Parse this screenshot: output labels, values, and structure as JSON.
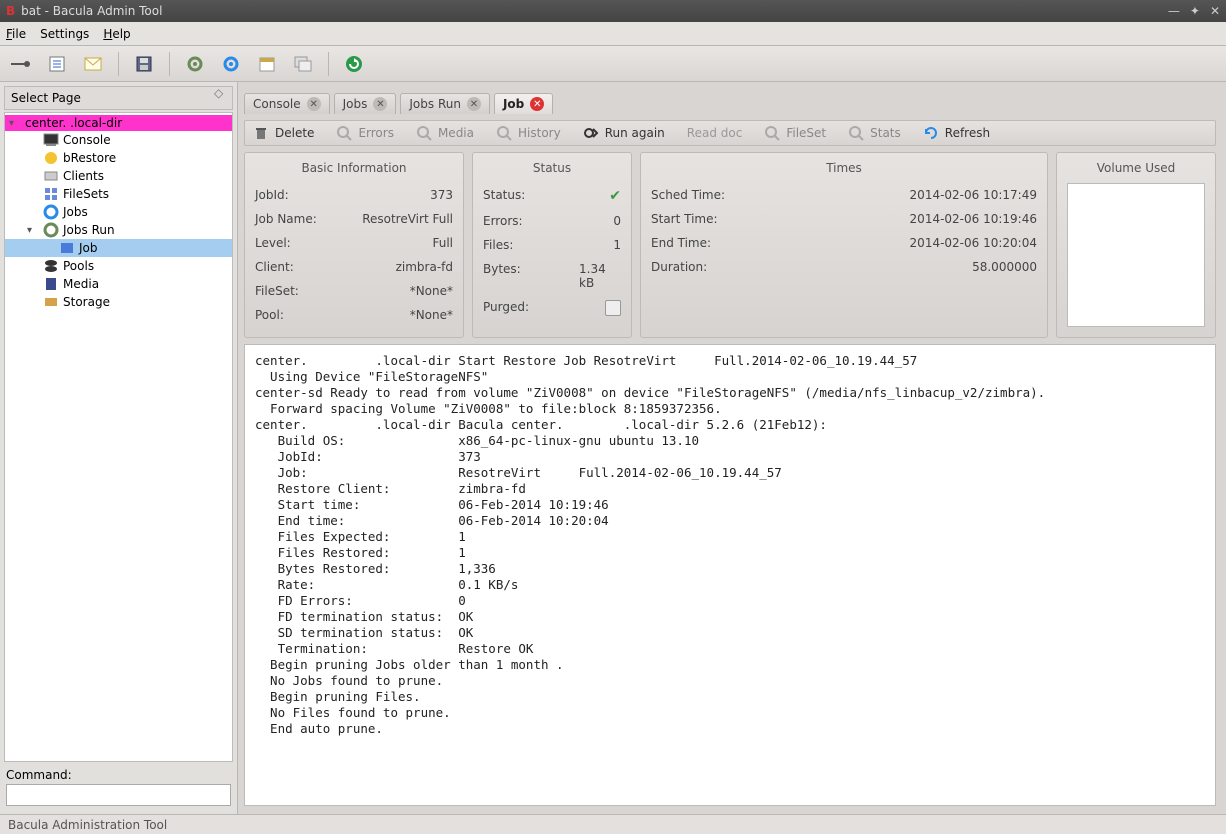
{
  "window": {
    "title": "bat - Bacula Admin Tool"
  },
  "menu": {
    "file": "File",
    "settings": "Settings",
    "help": "Help"
  },
  "sidebar": {
    "select_page": "Select Page",
    "root": "center.            .local-dir",
    "items": {
      "console": "Console",
      "brestore": "bRestore",
      "clients": "Clients",
      "filesets": "FileSets",
      "jobs": "Jobs",
      "jobsrun": "Jobs Run",
      "job": "Job",
      "pools": "Pools",
      "media": "Media",
      "storage": "Storage"
    },
    "command_label": "Command:"
  },
  "tabs": {
    "console": "Console",
    "jobs": "Jobs",
    "jobsrun": "Jobs Run",
    "job": "Job"
  },
  "actions": {
    "delete": "Delete",
    "errors": "Errors",
    "media": "Media",
    "history": "History",
    "run_again": "Run again",
    "read_doc": "Read doc",
    "fileset": "FileSet",
    "stats": "Stats",
    "refresh": "Refresh"
  },
  "panels": {
    "info": {
      "title": "Basic Information",
      "jobid_l": "JobId:",
      "jobid_v": "373",
      "jobname_l": "Job Name:",
      "jobname_v": "ResotreVirt      Full",
      "level_l": "Level:",
      "level_v": "Full",
      "client_l": "Client:",
      "client_v": "zimbra-fd",
      "fileset_l": "FileSet:",
      "fileset_v": "*None*",
      "pool_l": "Pool:",
      "pool_v": "*None*"
    },
    "status": {
      "title": "Status",
      "status_l": "Status:",
      "errors_l": "Errors:",
      "errors_v": "0",
      "files_l": "Files:",
      "files_v": "1",
      "bytes_l": "Bytes:",
      "bytes_v": "1.34 kB",
      "purged_l": "Purged:"
    },
    "times": {
      "title": "Times",
      "sched_l": "Sched Time:",
      "sched_v": "2014-02-06 10:17:49",
      "start_l": "Start Time:",
      "start_v": "2014-02-06 10:19:46",
      "end_l": "End Time:",
      "end_v": "2014-02-06 10:20:04",
      "dur_l": "Duration:",
      "dur_v": "58.000000"
    },
    "volused": {
      "title": "Volume Used"
    }
  },
  "log": "center.         .local-dir Start Restore Job ResotreVirt     Full.2014-02-06_10.19.44_57\n  Using Device \"FileStorageNFS\"\ncenter-sd Ready to read from volume \"ZiV0008\" on device \"FileStorageNFS\" (/media/nfs_linbacup_v2/zimbra).\n  Forward spacing Volume \"ZiV0008\" to file:block 8:1859372356.\ncenter.         .local-dir Bacula center.        .local-dir 5.2.6 (21Feb12):\n   Build OS:               x86_64-pc-linux-gnu ubuntu 13.10\n   JobId:                  373\n   Job:                    ResotreVirt     Full.2014-02-06_10.19.44_57\n   Restore Client:         zimbra-fd\n   Start time:             06-Feb-2014 10:19:46\n   End time:               06-Feb-2014 10:20:04\n   Files Expected:         1\n   Files Restored:         1\n   Bytes Restored:         1,336\n   Rate:                   0.1 KB/s\n   FD Errors:              0\n   FD termination status:  OK\n   SD termination status:  OK\n   Termination:            Restore OK\n  Begin pruning Jobs older than 1 month .\n  No Jobs found to prune.\n  Begin pruning Files.\n  No Files found to prune.\n  End auto prune.",
  "statusbar": "Bacula Administration Tool"
}
